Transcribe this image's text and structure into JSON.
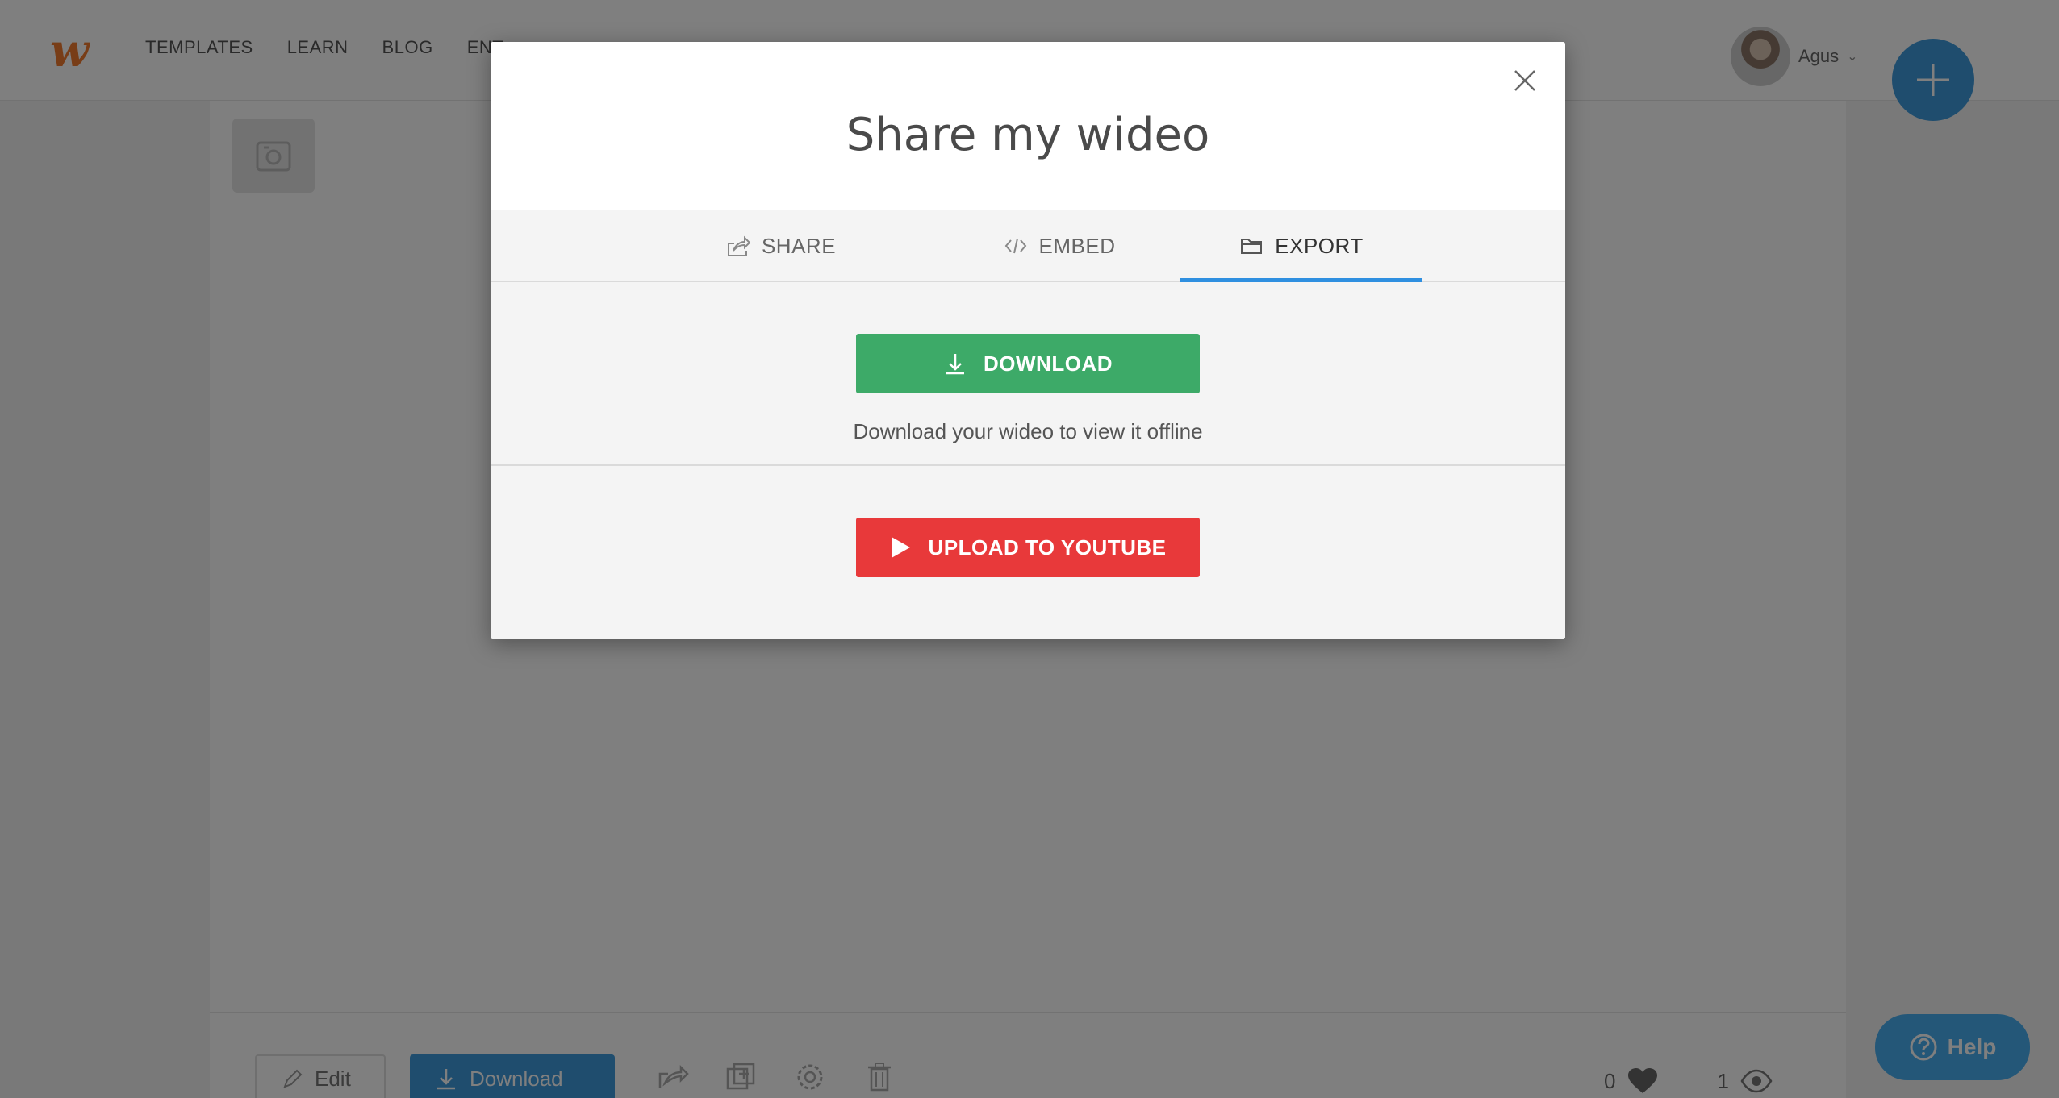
{
  "header": {
    "logo_text": "w",
    "nav": [
      "TEMPLATES",
      "LEARN",
      "BLOG",
      "ENT"
    ],
    "user_name": "Agus",
    "user_chevron": "⌄"
  },
  "bottom_bar": {
    "edit_label": "Edit",
    "download_label": "Download",
    "likes_count": "0",
    "views_count": "1"
  },
  "help": {
    "label": "Help"
  },
  "modal": {
    "title": "Share my wideo",
    "tabs": [
      {
        "label": "SHARE",
        "icon": "share-icon"
      },
      {
        "label": "EMBED",
        "icon": "code-icon"
      },
      {
        "label": "EXPORT",
        "icon": "folder-icon"
      }
    ],
    "active_tab": "EXPORT",
    "download_button": "DOWNLOAD",
    "download_description": "Download your wideo to view it offline",
    "youtube_button": "UPLOAD TO YOUTUBE"
  },
  "colors": {
    "accent_blue": "#2f8fe0",
    "download_green": "#3daa68",
    "youtube_red": "#e8393a",
    "logo_orange": "#f07a2e"
  }
}
